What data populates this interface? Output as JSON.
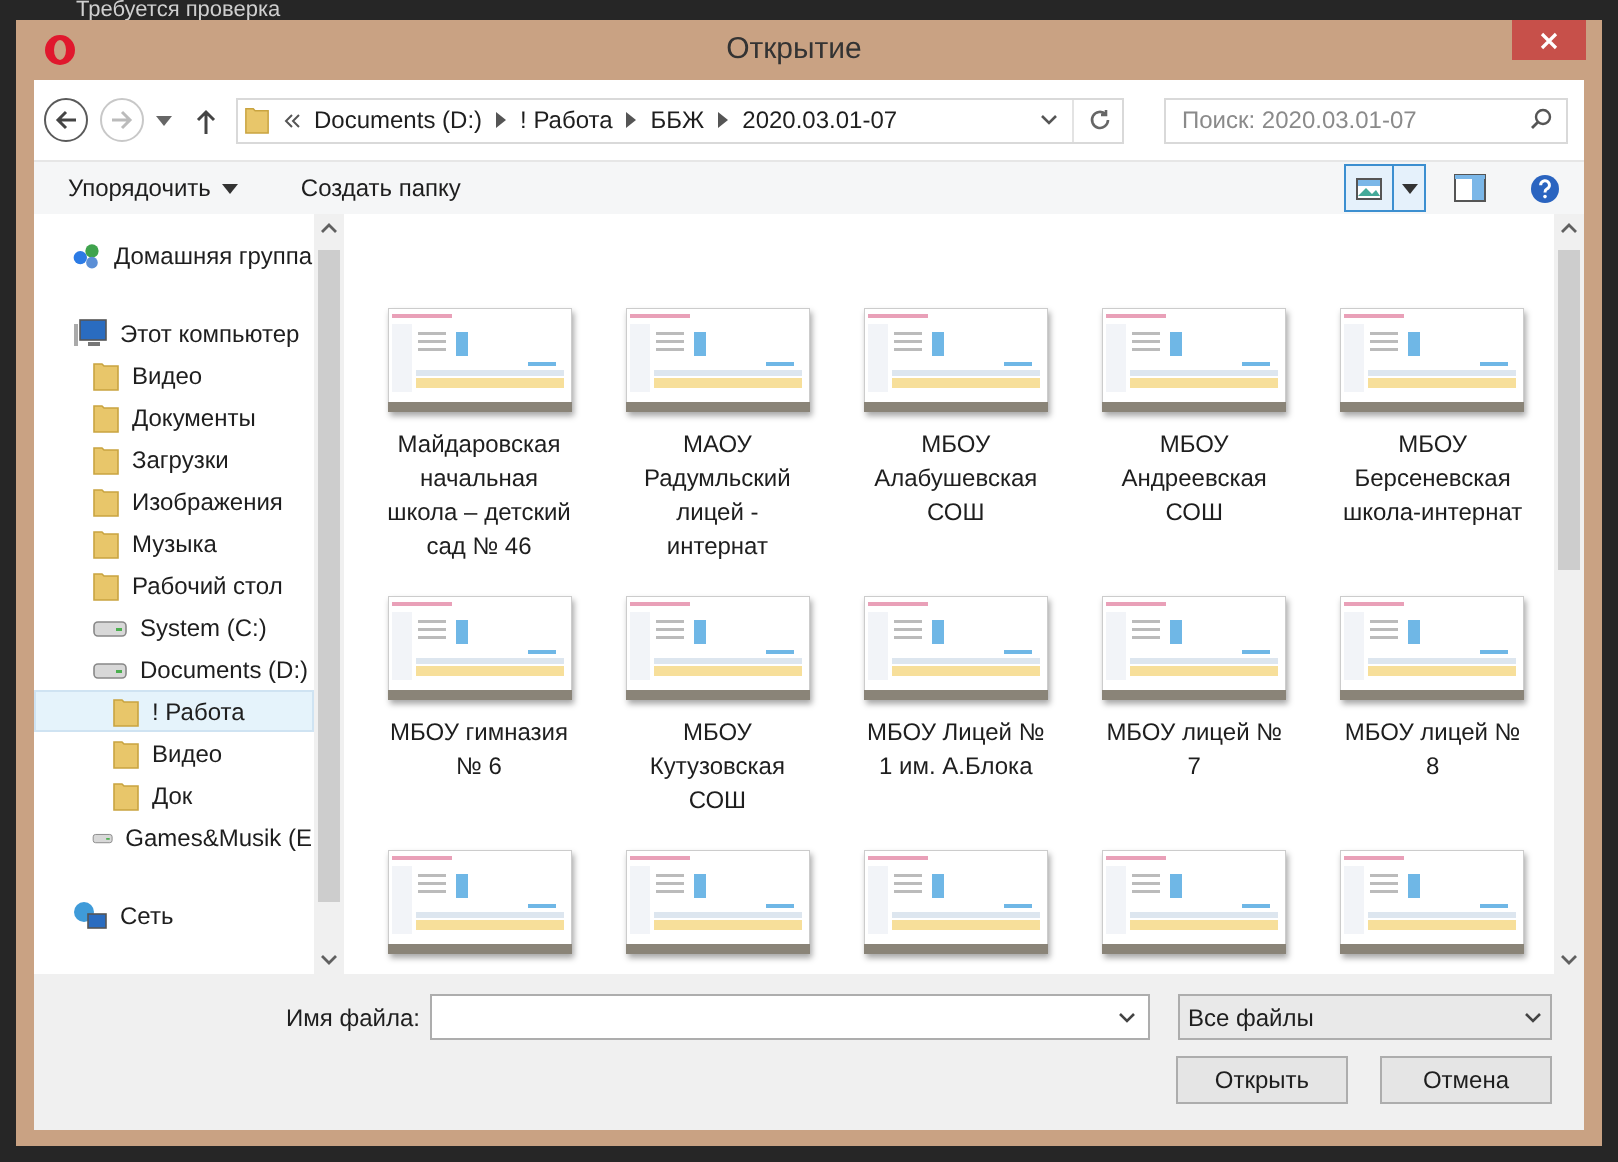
{
  "background_text": "Требуется проверка",
  "window": {
    "title": "Открытие"
  },
  "address": {
    "crumbs": [
      "Documents (D:)",
      "! Работа",
      "ББЖ",
      "2020.03.01-07"
    ],
    "search_placeholder": "Поиск: 2020.03.01-07"
  },
  "toolbar": {
    "organize": "Упорядочить",
    "new_folder": "Создать папку"
  },
  "sidebar": {
    "items": [
      {
        "label": "Домашняя группа",
        "kind": "homegroup",
        "selected": false
      },
      {
        "label": "Этот компьютер",
        "kind": "computer",
        "selected": false,
        "children": [
          {
            "label": "Видео",
            "kind": "folder",
            "selected": false
          },
          {
            "label": "Документы",
            "kind": "folder",
            "selected": false
          },
          {
            "label": "Загрузки",
            "kind": "folder",
            "selected": false
          },
          {
            "label": "Изображения",
            "kind": "folder",
            "selected": false
          },
          {
            "label": "Музыка",
            "kind": "folder",
            "selected": false
          },
          {
            "label": "Рабочий стол",
            "kind": "folder",
            "selected": false
          },
          {
            "label": "System (C:)",
            "kind": "drive",
            "selected": false
          },
          {
            "label": "Documents (D:)",
            "kind": "drive",
            "selected": false,
            "children": [
              {
                "label": "! Работа",
                "kind": "folder",
                "selected": true
              },
              {
                "label": "Видео",
                "kind": "folder",
                "selected": false
              },
              {
                "label": "Док",
                "kind": "folder",
                "selected": false
              }
            ]
          },
          {
            "label": "Games&Musik (E",
            "kind": "drive",
            "selected": false
          }
        ]
      },
      {
        "label": "Сеть",
        "kind": "network",
        "selected": false
      }
    ]
  },
  "files": [
    {
      "kind": "file",
      "name": "Майдаровская начальная школа – детский сад № 46"
    },
    {
      "kind": "file",
      "name": "МАОУ Радумльский лицей - интернат"
    },
    {
      "kind": "file",
      "name": "МБОУ Алабушевская СОШ"
    },
    {
      "kind": "file",
      "name": "МБОУ Андреевская СОШ"
    },
    {
      "kind": "file",
      "name": "МБОУ Берсеневская школа-интернат"
    },
    {
      "kind": "file",
      "name": "МБОУ гимназия № 6"
    },
    {
      "kind": "file",
      "name": "МБОУ Кутузовская СОШ"
    },
    {
      "kind": "file",
      "name": "МБОУ Лицей № 1 им. А.Блока"
    },
    {
      "kind": "file",
      "name": "МБОУ лицей № 7"
    },
    {
      "kind": "file",
      "name": "МБОУ лицей № 8"
    },
    {
      "kind": "cut"
    },
    {
      "kind": "cut"
    },
    {
      "kind": "cut"
    },
    {
      "kind": "cut"
    },
    {
      "kind": "cut"
    }
  ],
  "bottom": {
    "filename_label": "Имя файла:",
    "filter": "Все файлы",
    "open": "Открыть",
    "cancel": "Отмена"
  }
}
